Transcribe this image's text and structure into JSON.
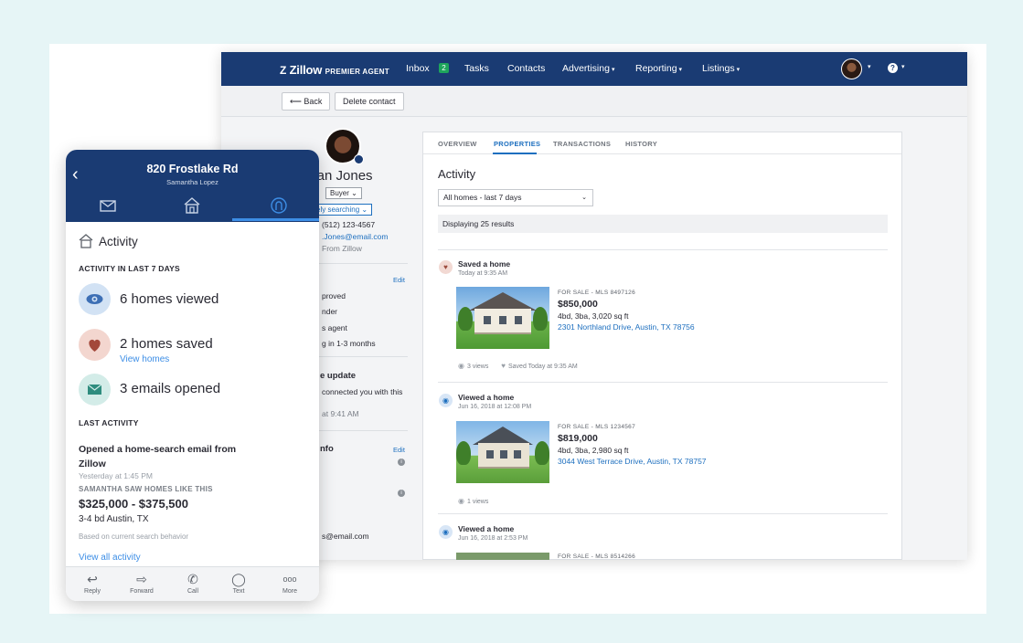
{
  "brand": {
    "logo_z": "Z",
    "logo_main": "Zillow",
    "logo_tag": "PREMIER AGENT"
  },
  "topnav": {
    "inbox": "Inbox",
    "inbox_badge": "2",
    "tasks": "Tasks",
    "contacts": "Contacts",
    "advertising": "Advertising",
    "reporting": "Reporting",
    "listings": "Listings",
    "help": "?",
    "caret": "▾"
  },
  "toolbar": {
    "back": "⟵ Back",
    "delete": "Delete contact"
  },
  "contact": {
    "name": "lian Jones",
    "role": "Buyer ⌄",
    "status": "vely searching ⌄",
    "phone": "(512) 123-4567",
    "email": ".Jones@email.com",
    "source": "From Zillow",
    "edit": "Edit",
    "detail_1": "proved",
    "detail_2": "nder",
    "detail_3": "s agent",
    "detail_4": "g in 1-3 months",
    "update_head": "e update",
    "update_text": "connected you with this",
    "update_time": "at 9:41 AM",
    "info_head": "nfo",
    "info_edit": "Edit",
    "info_email": "s@email.com",
    "info_icon": "i"
  },
  "tabs": [
    "OVERVIEW",
    "PROPERTIES",
    "TRANSACTIONS",
    "HISTORY"
  ],
  "activity": {
    "title": "Activity",
    "filter": "All homes - last 7 days",
    "filter_caret": "⌄",
    "results": "Displaying 25 results",
    "items": [
      {
        "icon": "heart-icon",
        "glyph": "♥",
        "title": "Saved a home",
        "time": "Today at 9:35 AM",
        "meta": "FOR SALE - MLS 8497126",
        "price": "$850,000",
        "spec": "4bd, 3ba, 3,020 sq ft",
        "address": "2301 Northland Drive, Austin, TX 78756",
        "views": "3 views",
        "saved": "Saved Today at 9:35 AM"
      },
      {
        "icon": "eye-icon",
        "glyph": "◉",
        "title": "Viewed a home",
        "time": "Jun 16, 2018 at 12:08 PM",
        "meta": "FOR SALE - MLS 1234567",
        "price": "$819,000",
        "spec": "4bd, 3ba, 2,980 sq ft",
        "address": "3044 West Terrace Drive, Austin, TX 78757",
        "views": "1 views"
      },
      {
        "icon": "eye-icon",
        "glyph": "◉",
        "title": "Viewed a home",
        "time": "Jun 16, 2018 at 2:53 PM",
        "meta": "FOR SALE - MLS 8514266"
      }
    ]
  },
  "phone": {
    "back": "‹",
    "title": "820 Frostlake Rd",
    "subtitle": "Samantha Lopez",
    "section": "Activity",
    "last7": "ACTIVITY IN LAST 7 DAYS",
    "stat_viewed": "6 homes viewed",
    "stat_saved": "2 homes saved",
    "view_homes": "View homes",
    "stat_emails": "3 emails opened",
    "last_activity": "LAST ACTIVITY",
    "last_title": "Opened a home-search email from Zillow",
    "last_time": "Yesterday at 1:45 PM",
    "saw": "SAMANTHA SAW HOMES LIKE THIS",
    "range": "$325,000 - $375,500",
    "bd": "3-4 bd Austin, TX",
    "based": "Based on current search behavior",
    "view_all": "View all activity",
    "actions": [
      {
        "label": "Reply",
        "glyph": "↩"
      },
      {
        "label": "Forward",
        "glyph": "⇨"
      },
      {
        "label": "Call",
        "glyph": "✆"
      },
      {
        "label": "Text",
        "glyph": "◯"
      },
      {
        "label": "More",
        "glyph": "ooo"
      }
    ]
  },
  "colors": {
    "nav": "#1a3b73",
    "link": "#1d6fbf",
    "accent": "#3d8ee6",
    "badge": "#1ea55c"
  }
}
